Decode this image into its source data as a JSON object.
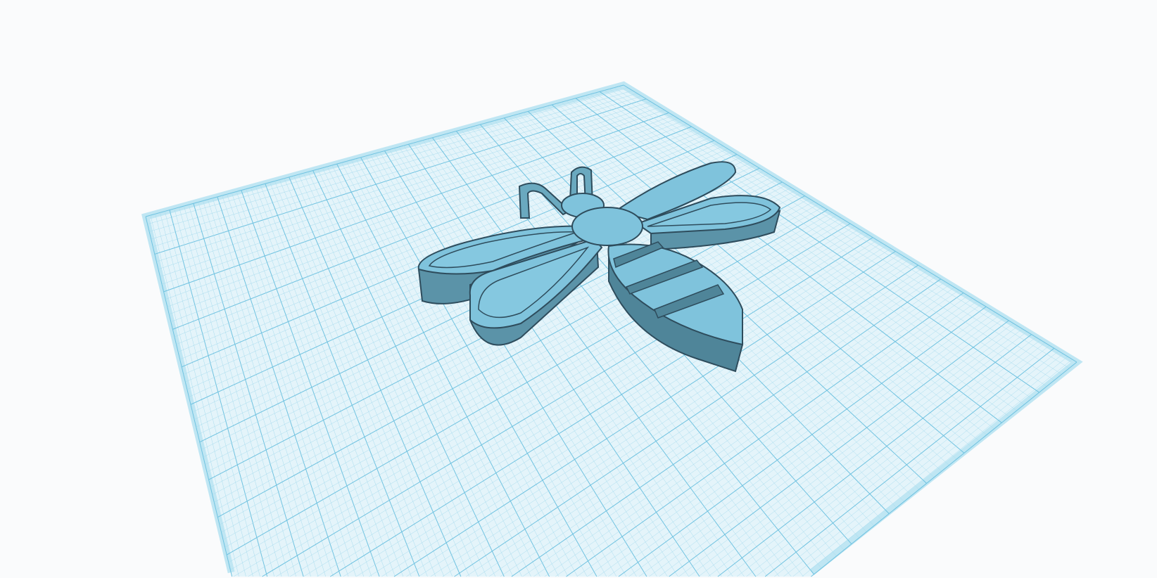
{
  "viewport": {
    "background_color": "#fafbfc",
    "workplane": {
      "fill_color": "#e4f4fa",
      "minor_line_color": "#a9dcee",
      "major_line_color": "#6fc2e0",
      "border_color": "#bfe6f3",
      "major_divisions": 20,
      "minor_per_major": 5
    },
    "model": {
      "name": "bee",
      "top_color": "#7fc3dc",
      "side_color": "#5b93a8",
      "edge_color": "#2e4c5c"
    }
  }
}
